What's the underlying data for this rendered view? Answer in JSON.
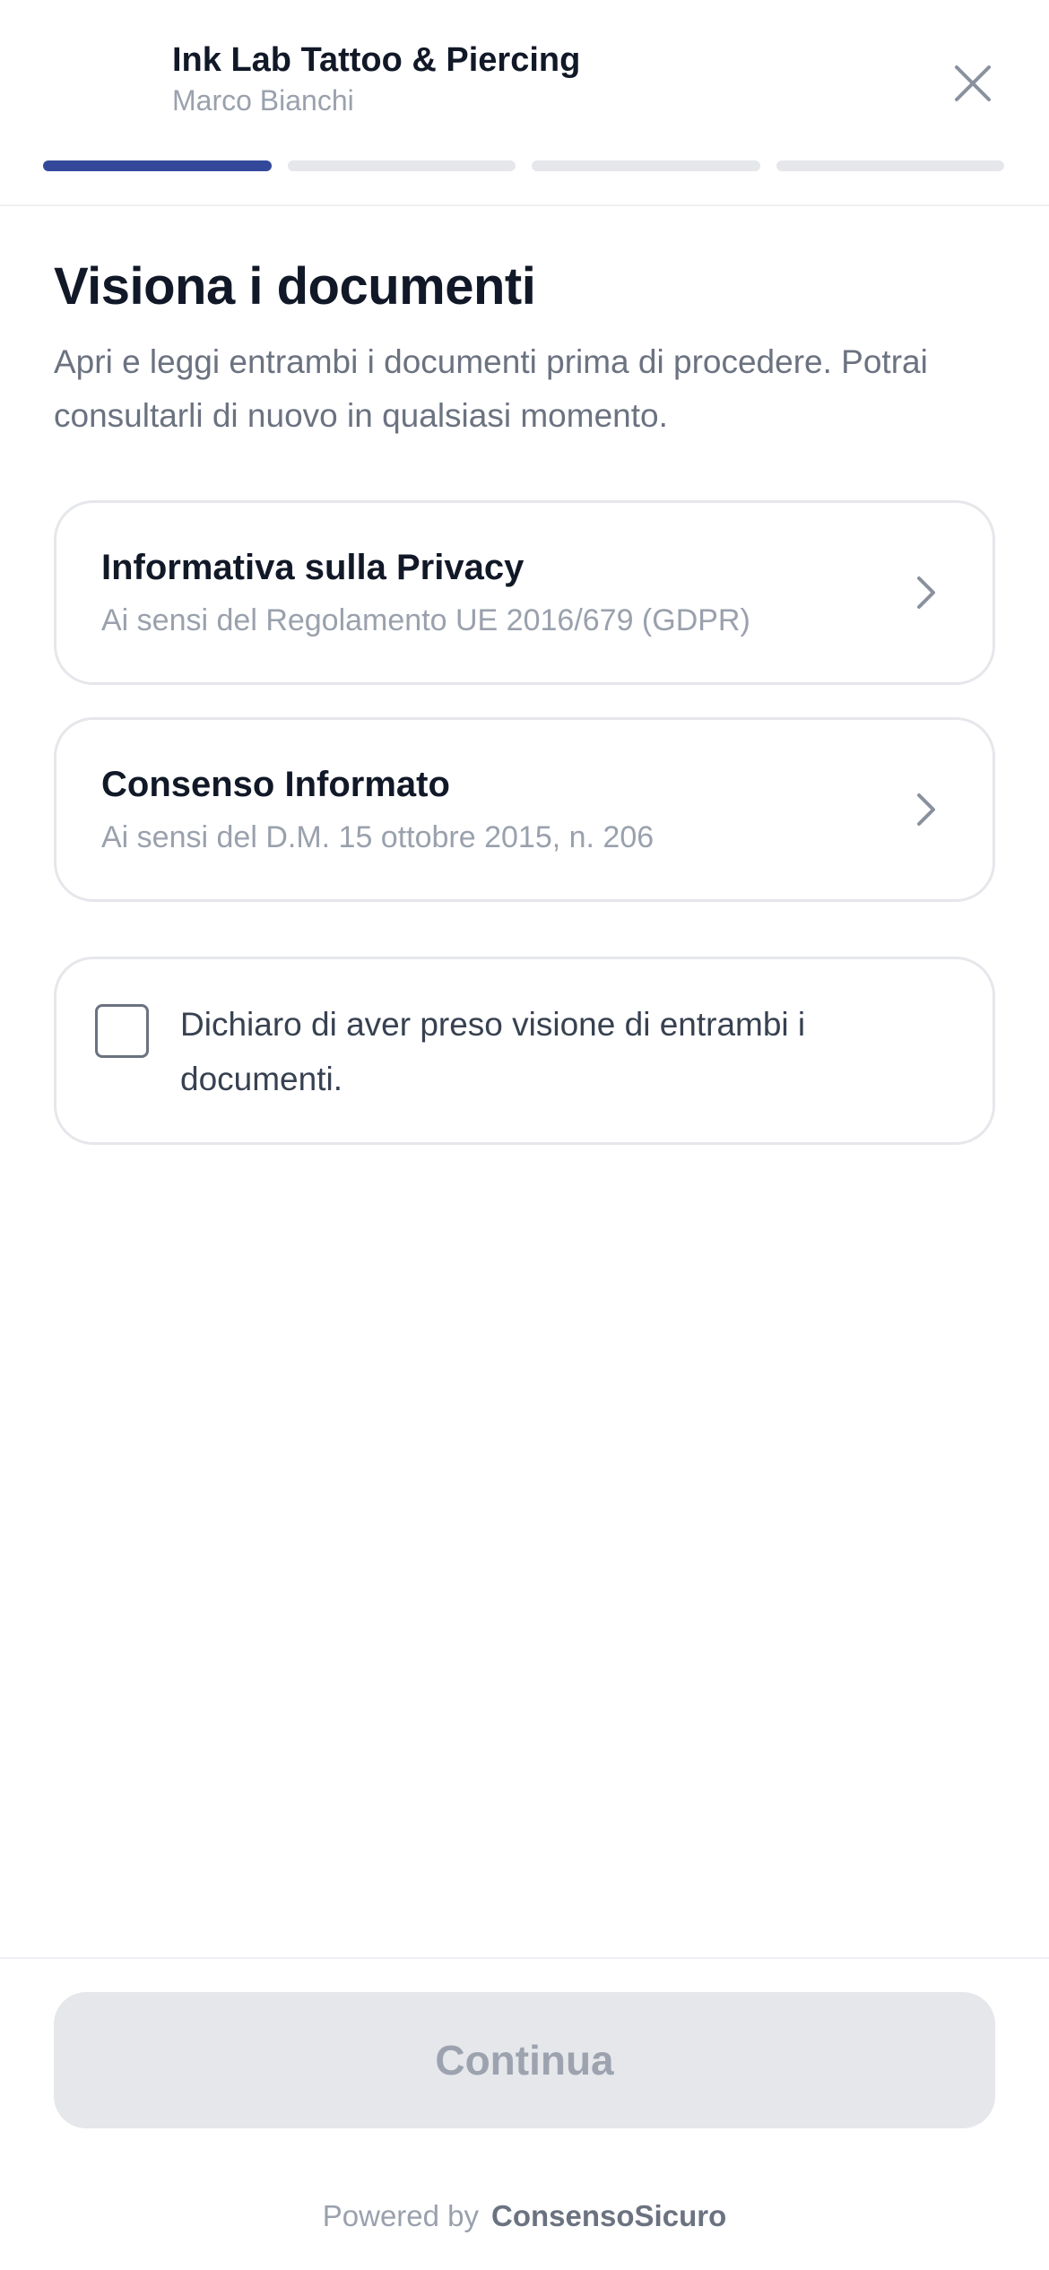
{
  "header": {
    "shop_name": "Ink Lab Tattoo & Piercing",
    "client_name": "Marco Bianchi",
    "close_icon": "close-icon",
    "progress": {
      "current_step": 1,
      "total_steps": 4
    }
  },
  "main": {
    "title": "Visiona i documenti",
    "intro": "Apri e leggi entrambi i documenti prima di procedere. Potrai consultarli di nuovo in qualsiasi momento.",
    "documents": [
      {
        "title": "Informativa sulla Privacy",
        "subtitle": "Ai sensi del Regolamento UE 2016/679 (GDPR)",
        "icon": "chevron-right-icon"
      },
      {
        "title": "Consenso Informato",
        "subtitle": "Ai sensi del D.M. 15 ottobre 2015, n. 206",
        "icon": "chevron-right-icon"
      }
    ],
    "confirmation": {
      "label": "Dichiaro di aver preso visione di entrambi i documenti.",
      "checked": false
    }
  },
  "footer": {
    "continue_label": "Continua",
    "continue_enabled": false,
    "powered_by": "Powered by",
    "brand": "ConsensoSicuro"
  },
  "colors": {
    "accent": "#34489a",
    "progress_inactive": "#e5e7eb",
    "text_primary": "#111827",
    "text_muted": "#9aa1ad",
    "button_disabled_bg": "#e5e7eb",
    "button_disabled_text": "#9ca3af"
  }
}
